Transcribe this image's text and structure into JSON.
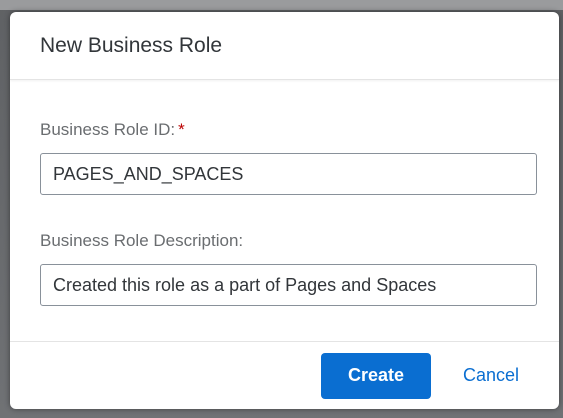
{
  "dialog": {
    "title": "New Business Role"
  },
  "form": {
    "role_id": {
      "label": "Business Role ID:",
      "required_marker": "*",
      "value": "PAGES_AND_SPACES"
    },
    "role_description": {
      "label": "Business Role Description:",
      "value": "Created this role as a part of Pages and Spaces"
    }
  },
  "footer": {
    "create_label": "Create",
    "cancel_label": "Cancel"
  },
  "colors": {
    "accent": "#0a6ed1",
    "required": "#bb0000",
    "label": "#6a6d70",
    "text": "#32363a"
  }
}
